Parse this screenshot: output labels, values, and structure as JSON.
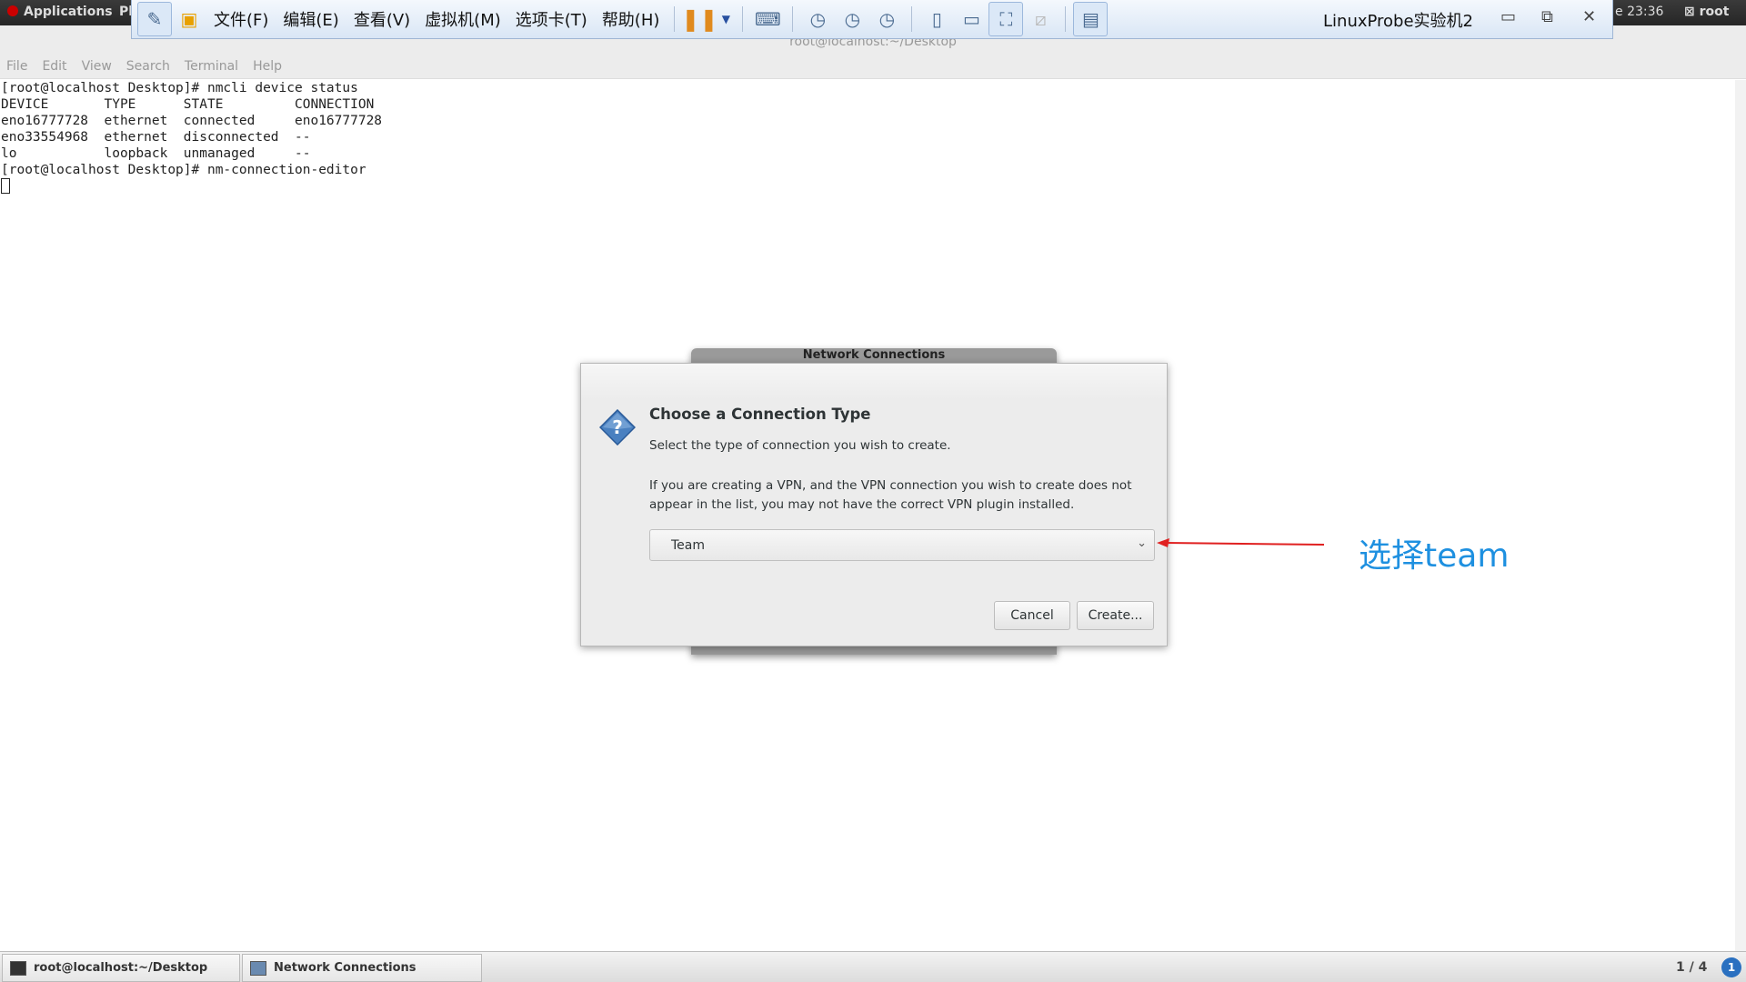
{
  "topbar": {
    "applications": "Applications",
    "places": "Pl",
    "clock": "e 23:36",
    "user": "root"
  },
  "vmware": {
    "menus": [
      "文件(F)",
      "编辑(E)",
      "查看(V)",
      "虚拟机(M)",
      "选项卡(T)",
      "帮助(H)"
    ],
    "title": "LinuxProbe实验机2"
  },
  "terminal": {
    "title": "root@localhost:~/Desktop",
    "menu": [
      "File",
      "Edit",
      "View",
      "Search",
      "Terminal",
      "Help"
    ],
    "lines": [
      "[root@localhost Desktop]# nmcli device status",
      "DEVICE       TYPE      STATE         CONNECTION",
      "eno16777728  ethernet  connected     eno16777728",
      "eno33554968  ethernet  disconnected  --",
      "lo           loopback  unmanaged     --",
      "[root@localhost Desktop]# nm-connection-editor"
    ]
  },
  "back_window": {
    "title": "Network Connections"
  },
  "dialog": {
    "title": "Choose a Connection Type",
    "subtitle": "Select the type of connection you wish to create.",
    "note": "If you are creating a VPN, and the VPN connection you wish to create does not appear in the list, you may not have the correct VPN plugin installed.",
    "selected_type": "Team",
    "cancel": "Cancel",
    "create": "Create..."
  },
  "annotation": {
    "text": "选择team",
    "color": "#1e90e0",
    "arrow_color": "#e02020"
  },
  "taskbar": {
    "items": [
      "root@localhost:~/Desktop",
      "Network Connections"
    ],
    "pager": "1 / 4",
    "notification": "1"
  }
}
